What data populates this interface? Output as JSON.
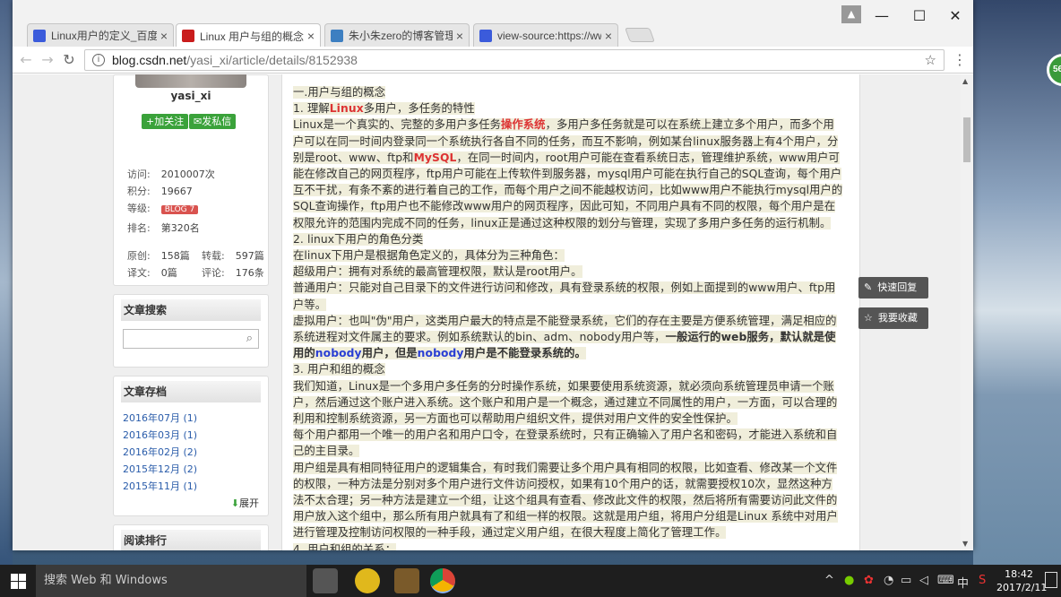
{
  "browser": {
    "tabs": [
      {
        "title": "Linux用户的定义_百度搜",
        "favicon_color": "#3b5bdb"
      },
      {
        "title": "Linux 用户与组的概念 -",
        "favicon_color": "#c91c1c"
      },
      {
        "title": "朱小朱zero的博客管理后",
        "favicon_color": "#3d7fc1"
      },
      {
        "title": "view-source:https://ww",
        "favicon_color": "#3b5bdb"
      }
    ],
    "url_host": "blog.csdn.net",
    "url_path": "/yasi_xi/article/details/8152938",
    "icons": {
      "back": "back-arrow-icon",
      "forward": "forward-arrow-icon",
      "reload": "reload-icon",
      "bookmark": "star-icon",
      "menu": "kebab-menu-icon"
    }
  },
  "sidebar": {
    "username": "yasi_xi",
    "follow_label": "+加关注",
    "message_label": "发私信",
    "stats": {
      "visits_label": "访问:",
      "visits_value": "2010007次",
      "points_label": "积分:",
      "points_value": "19667",
      "level_label": "等级:",
      "level_badge": "BLOG 7",
      "rank_label": "排名:",
      "rank_value": "第320名",
      "original_label": "原创:",
      "original_value": "158篇",
      "repost_label": "转载:",
      "repost_value": "597篇",
      "translate_label": "译文:",
      "translate_value": "0篇",
      "comments_label": "评论:",
      "comments_value": "176条"
    },
    "search_title": "文章搜索",
    "archive_title": "文章存档",
    "archive": [
      "2016年07月 (1)",
      "2016年03月 (1)",
      "2016年02月 (2)",
      "2015年12月 (2)",
      "2015年11月 (1)"
    ],
    "expand_label": "展开",
    "ranking_title": "阅读排行"
  },
  "article": {
    "heading": "一.用户与组的概念",
    "s1_title_pre": "1. 理解",
    "s1_title_hl": "Linux",
    "s1_title_post": "多用户，多任务的特性",
    "p1_a": "Linux是一个真实的、完整的多用户多任务",
    "p1_b": "操作系统",
    "p1_c": "，多用户多任务就是可以在系统上建立多个用户，而多个用户可以在同一时间内登录同一个系统执行各自不同的任务，而互不影响，例如某台linux服务器上有4个用户，分别是root、www、ftp和",
    "p1_d": "MySQL",
    "p1_e": "，在同一时间内，root用户可能在查看系统日志，管理维护系统，www用户可能在修改自己的网页程序，ftp用户可能在上传软件到服务器，mysql用户可能在执行自己的SQL查询，每个用户互不干扰，有条不紊的进行着自己的工作，而每个用户之间不能越权访问，比如www用户不能执行mysql用户的SQL查询操作，ftp用户也不能修改www用户的网页程序，因此可知，不同用户具有不同的权限，每个用户是在权限允许的范围内完成不同的任务，linux正是通过这种权限的划分与管理，实现了多用户多任务的运行机制。",
    "s2_title": "2. linux下用户的角色分类",
    "p2": " 在linux下用户是根据角色定义的，具体分为三种角色：",
    "p3": " 超级用户：拥有对系统的最高管理权限，默认是root用户。",
    "p4": " 普通用户：只能对自己目录下的文件进行访问和修改，具有登录系统的权限，例如上面提到的www用户、ftp用户等。",
    "p5_a": " 虚拟用户：也叫\"伪\"用户，这类用户最大的特点是不能登录系统，它们的存在主要是方便系统管理，满足相应的系统进程对文件属主的要求。例如系统默认的bin、adm、nobody用户等，",
    "p5_b": "一般运行的web服务，默认就是使用的",
    "p5_c": "nobody",
    "p5_d": "用户，但是",
    "p5_e": "nobody",
    "p5_f": "用户是不能登录系统的。",
    "s3_title": "3. 用户和组的概念",
    "p6": " 我们知道，Linux是一个多用户多任务的分时操作系统，如果要使用系统资源，就必须向系统管理员申请一个账户，然后通过这个账户进入系统。这个账户和用户是一个概念，通过建立不同属性的用户，一方面，可以合理的利用和控制系统资源，另一方面也可以帮助用户组织文件，提供对用户文件的安全性保护。",
    "p7": " 每个用户都用一个唯一的用户名和用户口令，在登录系统时，只有正确输入了用户名和密码，才能进入系统和自己的主目录。",
    "p8": " 用户组是具有相同特征用户的逻辑集合，有时我们需要让多个用户具有相同的权限，比如查看、修改某一个文件的权限，一种方法是分别对多个用户进行文件访问授权，如果有10个用户的话，就需要授权10次，显然这种方法不太合理；另一种方法是建立一个组，让这个组具有查看、修改此文件的权限，然后将所有需要访问此文件的用户放入这个组中，那么所有用户就具有了和组一样的权限。这就是用户组，将用户分组是Linux 系统中对用户进行管理及控制访问权限的一种手段，通过定义用户组，在很大程度上简化了管理工作。",
    "s4_title": "4. 用户和组的关系："
  },
  "float": {
    "reply_label": "快速回复",
    "favorite_label": "我要收藏"
  },
  "taskbar": {
    "search_placeholder": "搜索 Web 和 Windows",
    "time": "18:42",
    "date": "2017/2/11",
    "ime": "中"
  },
  "desktop": {
    "badge": "56"
  }
}
